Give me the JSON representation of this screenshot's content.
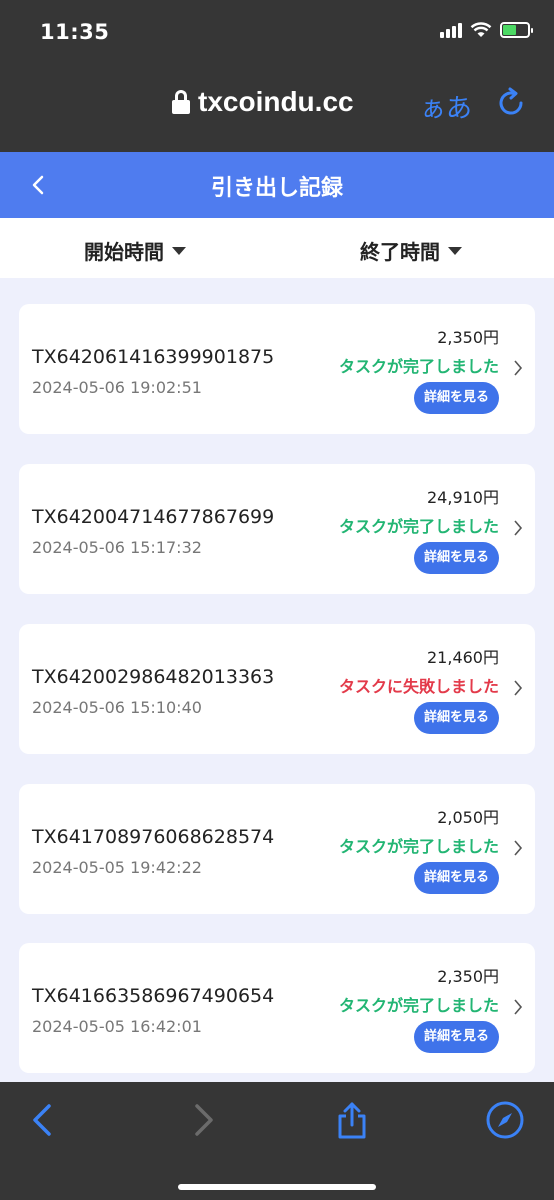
{
  "status_bar": {
    "time": "11:35"
  },
  "browser": {
    "url": "txcoindu.cc",
    "text_size_label": "ぁあ"
  },
  "header": {
    "title": "引き出し記録"
  },
  "filters": {
    "start_label": "開始時間",
    "end_label": "終了時間"
  },
  "records": [
    {
      "id": "TX642061416399901875",
      "date": "2024-05-06 19:02:51",
      "amount": "2,350円",
      "status": "タスクが完了しました",
      "status_type": "ok",
      "button": "詳細を見る"
    },
    {
      "id": "TX642004714677867699",
      "date": "2024-05-06 15:17:32",
      "amount": "24,910円",
      "status": "タスクが完了しました",
      "status_type": "ok",
      "button": "詳細を見る"
    },
    {
      "id": "TX642002986482013363",
      "date": "2024-05-06 15:10:40",
      "amount": "21,460円",
      "status": "タスクに失敗しました",
      "status_type": "fail",
      "button": "詳細を見る"
    },
    {
      "id": "TX641708976068628574",
      "date": "2024-05-05 19:42:22",
      "amount": "2,050円",
      "status": "タスクが完了しました",
      "status_type": "ok",
      "button": "詳細を見る"
    },
    {
      "id": "TX641663586967490654",
      "date": "2024-05-05 16:42:01",
      "amount": "2,350円",
      "status": "タスクが完了しました",
      "status_type": "ok",
      "button": "詳細を見る"
    }
  ],
  "colors": {
    "header_bg": "#4f7cef",
    "success": "#22b573",
    "failure": "#e33a4a",
    "button_bg": "#3f73ea",
    "browser_accent": "#3b82f6"
  },
  "icons": {
    "back": "chevron-left-icon",
    "lock": "lock-icon",
    "reload": "reload-icon",
    "share": "share-icon",
    "compass": "compass-icon"
  }
}
